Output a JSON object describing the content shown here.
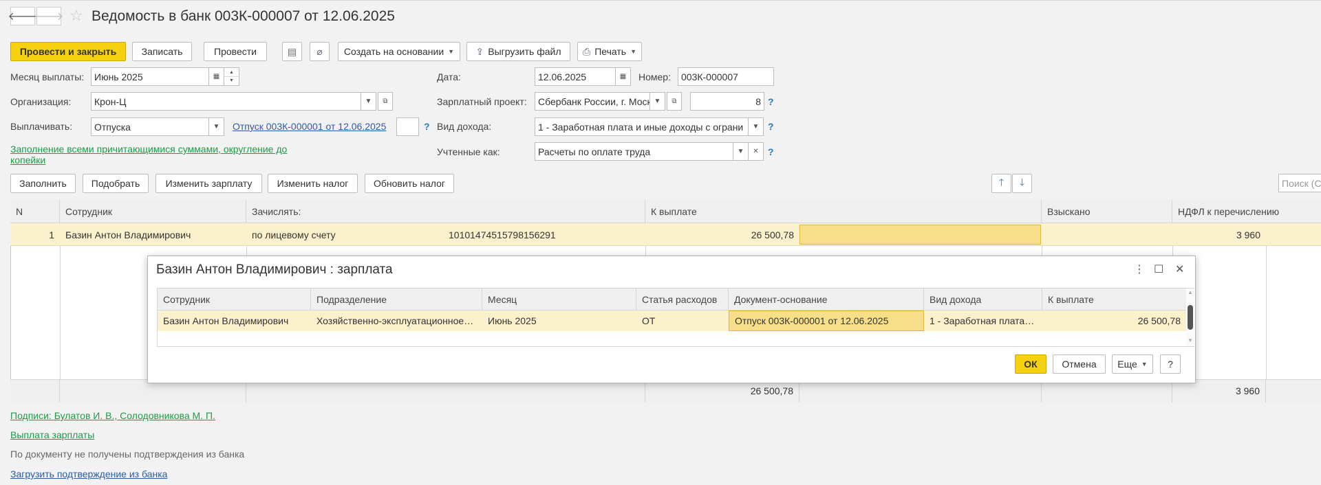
{
  "window": {
    "title": "Ведомость в банк 003К-000007 от 12.06.2025"
  },
  "nav": {
    "back_icon": "arrow-left-icon",
    "forward_icon": "arrow-right-icon"
  },
  "toolbar": {
    "post_close": "Провести и закрыть",
    "save": "Записать",
    "post": "Провести",
    "create_based": "Создать на основании",
    "export_file": "Выгрузить файл",
    "print": "Печать"
  },
  "form": {
    "month_label": "Месяц выплаты:",
    "month_value": "Июнь 2025",
    "org_label": "Организация:",
    "org_value": "Крон-Ц",
    "pay_label": "Выплачивать:",
    "pay_value": "Отпуска",
    "pay_doc_link": "Отпуск 003К-000001 от 12.06.2025",
    "date_label": "Дата:",
    "date_value": "12.06.2025",
    "number_label": "Номер:",
    "number_value": "003К-000007",
    "salary_project_label": "Зарплатный проект:",
    "salary_project_value": "Сбербанк России, г. Моск",
    "salary_project_count": "8",
    "income_type_label": "Вид дохода:",
    "income_type_value": "1 - Заработная плата и иные доходы с ограни",
    "accounted_label": "Учтенные как:",
    "accounted_value": "Расчеты по оплате труда",
    "fill_link": "Заполнение всеми причитающимися суммами, округление до копейки"
  },
  "table_toolbar": {
    "fill": "Заполнить",
    "pick": "Подобрать",
    "change_salary": "Изменить зарплату",
    "change_tax": "Изменить налог",
    "update_tax": "Обновить налог",
    "search_placeholder": "Поиск (С"
  },
  "table": {
    "headers": [
      "N",
      "Сотрудник",
      "Зачислять:",
      "К выплате",
      "Взыскано",
      "НДФЛ к перечислению"
    ],
    "rows": [
      {
        "n": "1",
        "employee": "Базин Антон Владимирович",
        "credit_to": "по лицевому счету",
        "account": "10101474515798156291",
        "to_pay": "26 500,78",
        "collected": "",
        "ndfl": "3 960"
      }
    ],
    "footer": {
      "to_pay": "26 500,78",
      "ndfl": "3 960"
    }
  },
  "dialog": {
    "title": "Базин Антон Владимирович : зарплата",
    "headers": [
      "Сотрудник",
      "Подразделение",
      "Месяц",
      "Статья расходов",
      "Документ-основание",
      "Вид дохода",
      "К выплате"
    ],
    "row": {
      "employee": "Базин Антон Владимирович",
      "department": "Хозяйственно-эксплуатационное…",
      "month": "Июнь 2025",
      "expense": "ОТ",
      "base_doc": "Отпуск 003К-000001 от 12.06.2025",
      "income_type": "1 - Заработная плата…",
      "to_pay": "26 500,78"
    },
    "ok": "ОК",
    "cancel": "Отмена",
    "more": "Еще",
    "help": "?"
  },
  "bottom": {
    "signatures_link": "Подписи: Булатов И. В., Солодовникова М. П.",
    "payout_link": "Выплата зарплаты",
    "status_text": "По документу не получены подтверждения из банка",
    "load_link": "Загрузить подтверждение из банка"
  },
  "colors": {
    "accent": "#f5d10f",
    "link": "#2a5ca8",
    "green_link": "#1f9a47",
    "row_selected": "#fbf1cc"
  }
}
